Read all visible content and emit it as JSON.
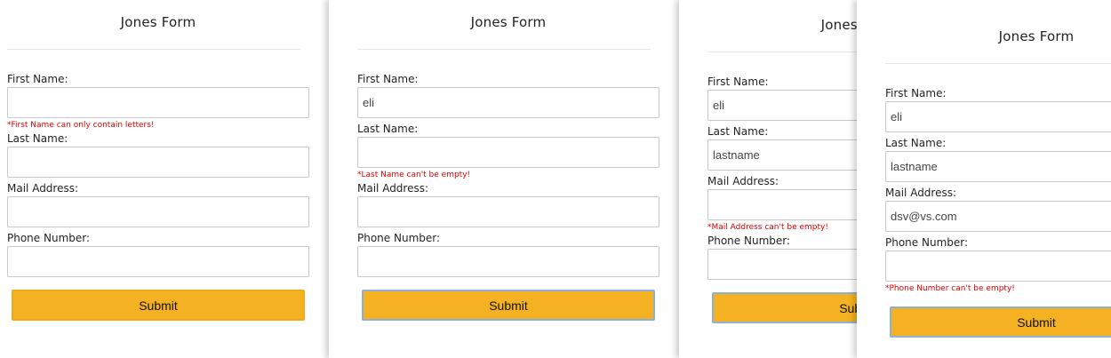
{
  "panels": [
    {
      "title": "Jones Form",
      "fields": [
        {
          "label": "First Name:",
          "value": "",
          "error": "*First Name can only contain letters!"
        },
        {
          "label": "Last Name:",
          "value": "",
          "error": ""
        },
        {
          "label": "Mail Address:",
          "value": "",
          "error": ""
        },
        {
          "label": "Phone Number:",
          "value": "",
          "error": ""
        }
      ],
      "submit_label": "Submit"
    },
    {
      "title": "Jones Form",
      "fields": [
        {
          "label": "First Name:",
          "value": "eli",
          "error": ""
        },
        {
          "label": "Last Name:",
          "value": "",
          "error": "*Last Name can't be empty!"
        },
        {
          "label": "Mail Address:",
          "value": "",
          "error": ""
        },
        {
          "label": "Phone Number:",
          "value": "",
          "error": ""
        }
      ],
      "submit_label": "Submit"
    },
    {
      "title": "Jones Form",
      "fields": [
        {
          "label": "First Name:",
          "value": "eli",
          "error": ""
        },
        {
          "label": "Last Name:",
          "value": "lastname",
          "error": ""
        },
        {
          "label": "Mail Address:",
          "value": "",
          "error": "*Mail Address can't be empty!"
        },
        {
          "label": "Phone Number:",
          "value": "",
          "error": ""
        }
      ],
      "submit_label": "Submit"
    },
    {
      "title": "Jones Form",
      "fields": [
        {
          "label": "First Name:",
          "value": "eli",
          "error": ""
        },
        {
          "label": "Last Name:",
          "value": "lastname",
          "error": ""
        },
        {
          "label": "Mail Address:",
          "value": "dsv@vs.com",
          "error": ""
        },
        {
          "label": "Phone Number:",
          "value": "",
          "error": "*Phone Number can't be empty!"
        }
      ],
      "submit_label": "Submit"
    }
  ]
}
